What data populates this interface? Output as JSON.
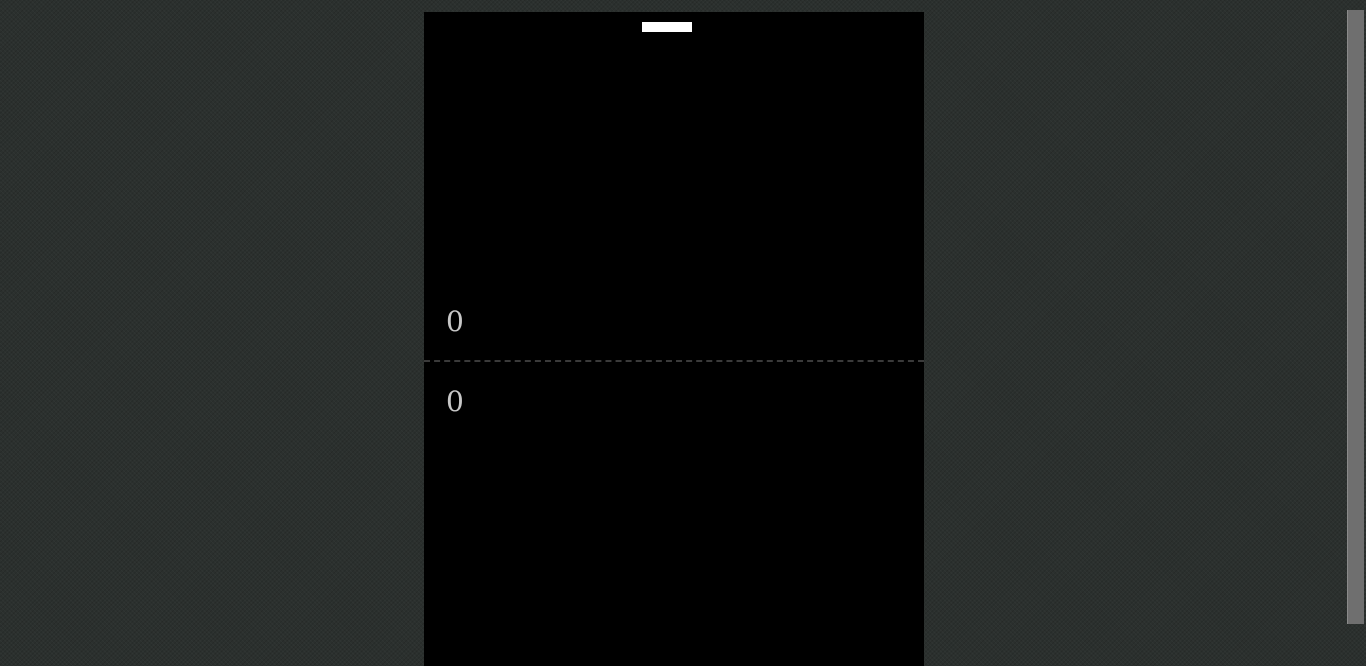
{
  "game": {
    "score_top": "0",
    "score_bottom": "0"
  },
  "colors": {
    "background": "#2b302e",
    "board": "#000000",
    "paddle": "#ffffff",
    "score": "#c8c8c8",
    "center_line": "#3a3a3a"
  }
}
